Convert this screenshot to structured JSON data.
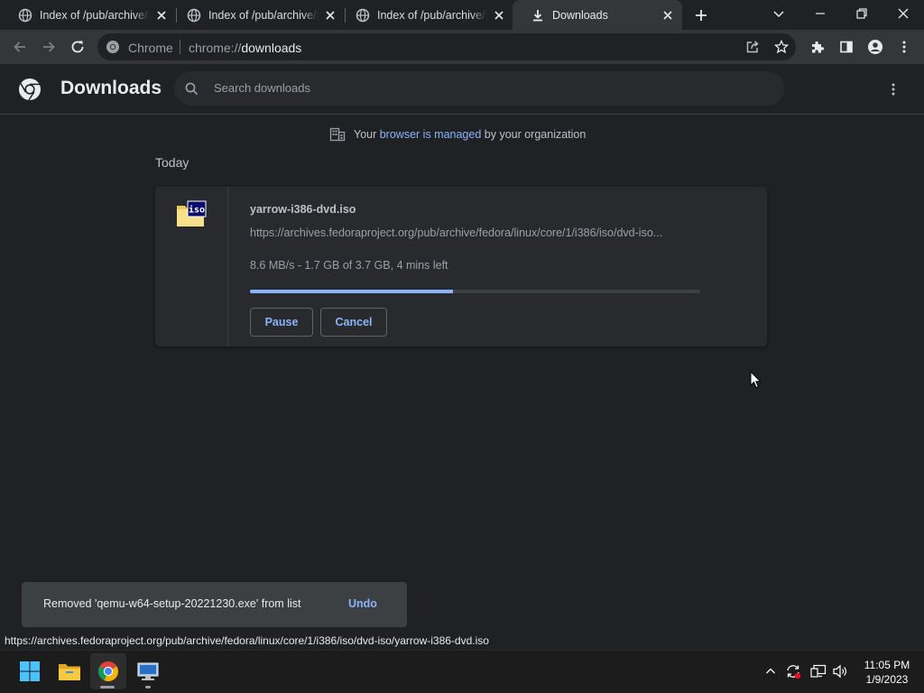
{
  "tabs": [
    {
      "title": "Index of /pub/archive/fedora",
      "active": false
    },
    {
      "title": "Index of /pub/archive/fedora",
      "active": false
    },
    {
      "title": "Index of /pub/archive/fedora",
      "active": false
    },
    {
      "title": "Downloads",
      "active": true
    }
  ],
  "toolbar": {
    "omnibox_chip": "Chrome",
    "url_scheme": "chrome://",
    "url_host": "downloads"
  },
  "downloads": {
    "title": "Downloads",
    "search_placeholder": "Search downloads",
    "managed_prefix": "Your ",
    "managed_link": "browser is managed",
    "managed_suffix": " by your organization",
    "section_label": "Today",
    "item": {
      "filename": "yarrow-i386-dvd.iso",
      "url": "https://archives.fedoraproject.org/pub/archive/fedora/linux/core/1/i386/iso/dvd-iso...",
      "status": "8.6 MB/s - 1.7 GB of 3.7 GB, 4 mins left",
      "progress_fraction": 0.45,
      "icon_label": "iso",
      "pause_label": "Pause",
      "cancel_label": "Cancel"
    }
  },
  "toast": {
    "message": "Removed 'qemu-w64-setup-20221230.exe' from list",
    "undo_label": "Undo"
  },
  "status_bubble": "https://archives.fedoraproject.org/pub/archive/fedora/linux/core/1/i386/iso/dvd-iso/yarrow-i386-dvd.iso",
  "taskbar": {
    "time": "11:05 PM",
    "date": "1/9/2023"
  },
  "colors": {
    "accent": "#8ab4f8",
    "background": "#202124",
    "card": "#292a2d"
  }
}
